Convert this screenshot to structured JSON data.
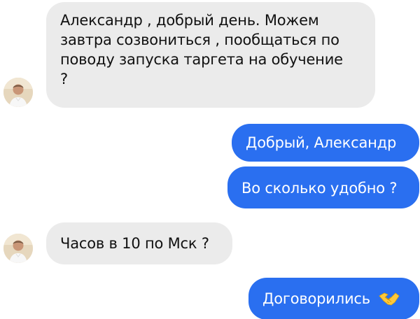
{
  "messages": [
    {
      "id": "m1",
      "direction": "incoming",
      "lines": [
        "Александр , добрый день. Можем",
        "завтра созвониться , пообщаться по",
        "поводу запуска таргета на обучение",
        "?"
      ]
    },
    {
      "id": "m2",
      "direction": "outgoing",
      "text": "Добрый, Александр"
    },
    {
      "id": "m3",
      "direction": "outgoing",
      "text": "Во сколько удобно ?"
    },
    {
      "id": "m4",
      "direction": "incoming",
      "text": "Часов в 10 по Мск ?"
    },
    {
      "id": "m5",
      "direction": "outgoing",
      "text": "Договорились",
      "emoji": "handshake-emoji"
    }
  ],
  "colors": {
    "incoming_bubble": "#ebebeb",
    "outgoing_bubble": "#2a6ff0",
    "incoming_text": "#111111",
    "outgoing_text": "#ffffff"
  },
  "icons": {
    "avatar": "contact-avatar",
    "emoji": "handshake-emoji"
  }
}
